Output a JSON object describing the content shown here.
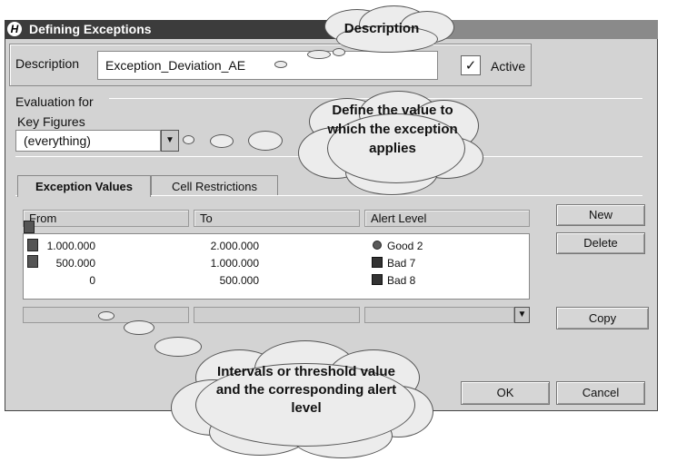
{
  "window": {
    "title": "Defining Exceptions"
  },
  "description": {
    "label": "Description",
    "value": "Exception_Deviation_AE",
    "active_label": "Active",
    "active_checked": "✓"
  },
  "evaluation": {
    "label": "Evaluation for",
    "key_figures_label": "Key Figures",
    "selected": "(everything)"
  },
  "tabs": [
    {
      "label": "Exception Values"
    },
    {
      "label": "Cell Restrictions"
    }
  ],
  "table": {
    "headers": {
      "from": "From",
      "to": "To",
      "alert": "Alert Level"
    },
    "rows": [
      {
        "from": "1.000.000",
        "to": "2.000.000",
        "alert": "Good 2"
      },
      {
        "from": "500.000",
        "to": "1.000.000",
        "alert": "Bad 7"
      },
      {
        "from": "0",
        "to": "500.000",
        "alert": "Bad 8"
      }
    ]
  },
  "buttons": {
    "new": "New",
    "delete": "Delete",
    "copy": "Copy",
    "ok": "OK",
    "cancel": "Cancel"
  },
  "callouts": {
    "description": "Description",
    "value": "Define the value to which the exception applies",
    "intervals": "Intervals or threshold value and the corresponding alert level"
  },
  "colors": {
    "titlebar": "#3c3c3c",
    "dialog": "#d3d3d3",
    "cloud": "#ececec"
  },
  "icons": {
    "title": "app-logo-icon",
    "row": "table-row-icon",
    "alert_good": "circle-icon",
    "alert_bad": "square-icon"
  }
}
